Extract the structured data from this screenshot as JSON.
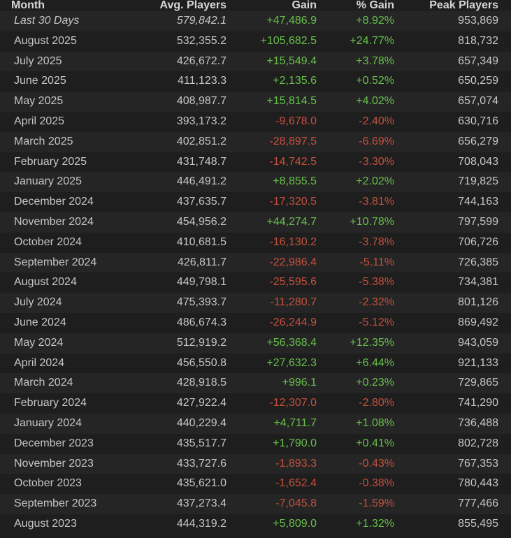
{
  "headers": {
    "month": "Month",
    "avg": "Avg. Players",
    "gain": "Gain",
    "pct": "% Gain",
    "peak": "Peak Players"
  },
  "colors": {
    "background": "#1e1e1e",
    "row_alt": "#252525",
    "positive": "#66c04a",
    "negative": "#c5503d",
    "text": "#c6c6c6"
  },
  "rows": [
    {
      "month": "Last 30 Days",
      "avg": "579,842.1",
      "gain": "+47,486.9",
      "pct": "+8.92%",
      "peak": "953,869",
      "trend": "pos"
    },
    {
      "month": "August 2025",
      "avg": "532,355.2",
      "gain": "+105,682.5",
      "pct": "+24.77%",
      "peak": "818,732",
      "trend": "pos"
    },
    {
      "month": "July 2025",
      "avg": "426,672.7",
      "gain": "+15,549.4",
      "pct": "+3.78%",
      "peak": "657,349",
      "trend": "pos"
    },
    {
      "month": "June 2025",
      "avg": "411,123.3",
      "gain": "+2,135.6",
      "pct": "+0.52%",
      "peak": "650,259",
      "trend": "pos"
    },
    {
      "month": "May 2025",
      "avg": "408,987.7",
      "gain": "+15,814.5",
      "pct": "+4.02%",
      "peak": "657,074",
      "trend": "pos"
    },
    {
      "month": "April 2025",
      "avg": "393,173.2",
      "gain": "-9,678.0",
      "pct": "-2.40%",
      "peak": "630,716",
      "trend": "neg"
    },
    {
      "month": "March 2025",
      "avg": "402,851.2",
      "gain": "-28,897.5",
      "pct": "-6.69%",
      "peak": "656,279",
      "trend": "neg"
    },
    {
      "month": "February 2025",
      "avg": "431,748.7",
      "gain": "-14,742.5",
      "pct": "-3.30%",
      "peak": "708,043",
      "trend": "neg"
    },
    {
      "month": "January 2025",
      "avg": "446,491.2",
      "gain": "+8,855.5",
      "pct": "+2.02%",
      "peak": "719,825",
      "trend": "pos"
    },
    {
      "month": "December 2024",
      "avg": "437,635.7",
      "gain": "-17,320.5",
      "pct": "-3.81%",
      "peak": "744,163",
      "trend": "neg"
    },
    {
      "month": "November 2024",
      "avg": "454,956.2",
      "gain": "+44,274.7",
      "pct": "+10.78%",
      "peak": "797,599",
      "trend": "pos"
    },
    {
      "month": "October 2024",
      "avg": "410,681.5",
      "gain": "-16,130.2",
      "pct": "-3.78%",
      "peak": "706,726",
      "trend": "neg"
    },
    {
      "month": "September 2024",
      "avg": "426,811.7",
      "gain": "-22,986.4",
      "pct": "-5.11%",
      "peak": "726,385",
      "trend": "neg"
    },
    {
      "month": "August 2024",
      "avg": "449,798.1",
      "gain": "-25,595.6",
      "pct": "-5.38%",
      "peak": "734,381",
      "trend": "neg"
    },
    {
      "month": "July 2024",
      "avg": "475,393.7",
      "gain": "-11,280.7",
      "pct": "-2.32%",
      "peak": "801,126",
      "trend": "neg"
    },
    {
      "month": "June 2024",
      "avg": "486,674.3",
      "gain": "-26,244.9",
      "pct": "-5.12%",
      "peak": "869,492",
      "trend": "neg"
    },
    {
      "month": "May 2024",
      "avg": "512,919.2",
      "gain": "+56,368.4",
      "pct": "+12.35%",
      "peak": "943,059",
      "trend": "pos"
    },
    {
      "month": "April 2024",
      "avg": "456,550.8",
      "gain": "+27,632.3",
      "pct": "+6.44%",
      "peak": "921,133",
      "trend": "pos"
    },
    {
      "month": "March 2024",
      "avg": "428,918.5",
      "gain": "+996.1",
      "pct": "+0.23%",
      "peak": "729,865",
      "trend": "pos"
    },
    {
      "month": "February 2024",
      "avg": "427,922.4",
      "gain": "-12,307.0",
      "pct": "-2.80%",
      "peak": "741,290",
      "trend": "neg"
    },
    {
      "month": "January 2024",
      "avg": "440,229.4",
      "gain": "+4,711.7",
      "pct": "+1.08%",
      "peak": "736,488",
      "trend": "pos"
    },
    {
      "month": "December 2023",
      "avg": "435,517.7",
      "gain": "+1,790.0",
      "pct": "+0.41%",
      "peak": "802,728",
      "trend": "pos"
    },
    {
      "month": "November 2023",
      "avg": "433,727.6",
      "gain": "-1,893.3",
      "pct": "-0.43%",
      "peak": "767,353",
      "trend": "neg"
    },
    {
      "month": "October 2023",
      "avg": "435,621.0",
      "gain": "-1,652.4",
      "pct": "-0.38%",
      "peak": "780,443",
      "trend": "neg"
    },
    {
      "month": "September 2023",
      "avg": "437,273.4",
      "gain": "-7,045.8",
      "pct": "-1.59%",
      "peak": "777,466",
      "trend": "neg"
    },
    {
      "month": "August 2023",
      "avg": "444,319.2",
      "gain": "+5,809.0",
      "pct": "+1.32%",
      "peak": "855,495",
      "trend": "pos"
    }
  ]
}
